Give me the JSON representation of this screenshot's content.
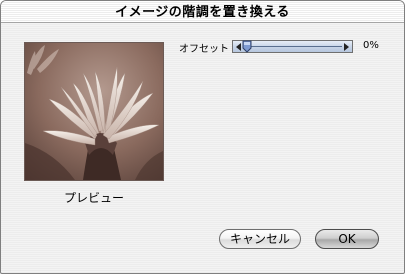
{
  "dialog": {
    "title": "イメージの階調を置き換える"
  },
  "preview": {
    "label": "プレビュー"
  },
  "offset": {
    "label": "オフセット",
    "value_text": "0%",
    "value": 0
  },
  "buttons": {
    "cancel_label": "キャンセル",
    "ok_label": "OK"
  },
  "colors": {
    "preview_tone": "#8a6a5e",
    "slider_track": "#c9d6e8",
    "window_bg": "#efefef"
  },
  "icons": {
    "slider_left": "triangle-left-icon",
    "slider_right": "triangle-right-icon",
    "slider_thumb": "slider-thumb-icon"
  }
}
